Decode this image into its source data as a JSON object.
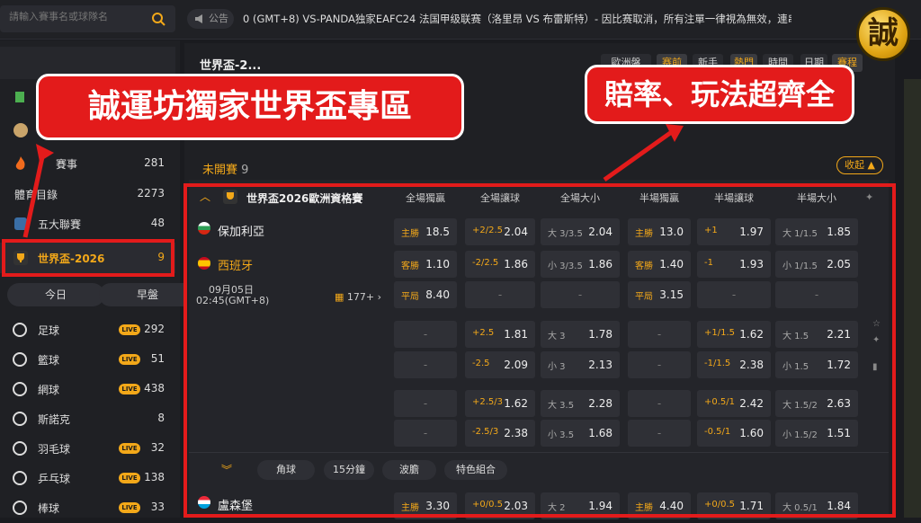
{
  "search": {
    "placeholder": "請輸入賽事名或球隊名"
  },
  "announcement": {
    "label": "公告",
    "text": "0 (GMT+8) VS-PANDA独家EAFC24 法国甲级联赛（洛里昂 VS 布雷斯特）- 因比赛取消，所有注單一律視為無效，連串注"
  },
  "logo_char": "誠",
  "sidebar": {
    "items_top": [
      {
        "label": "賽事",
        "count": "281"
      },
      {
        "label": "體育目錄",
        "count": "2273"
      },
      {
        "label": "五大聯賽",
        "count": "48"
      }
    ],
    "worldcup": {
      "label": "世界盃-2026",
      "count": "9"
    },
    "today_label": "今日",
    "early_label": "早盤",
    "sports": [
      {
        "label": "足球",
        "live": "LIVE",
        "count": "292",
        "icon": "soccer-icon"
      },
      {
        "label": "籃球",
        "live": "LIVE",
        "count": "51",
        "icon": "basketball-icon"
      },
      {
        "label": "網球",
        "live": "LIVE",
        "count": "438",
        "icon": "tennis-icon"
      },
      {
        "label": "斯諾克",
        "live": "",
        "count": "8",
        "icon": "snooker-icon"
      },
      {
        "label": "羽毛球",
        "live": "LIVE",
        "count": "32",
        "icon": "badminton-icon"
      },
      {
        "label": "乒乓球",
        "live": "LIVE",
        "count": "138",
        "icon": "pingpong-icon"
      },
      {
        "label": "棒球",
        "live": "LIVE",
        "count": "33",
        "icon": "baseball-icon"
      }
    ]
  },
  "main": {
    "breadcrumb": "世界盃-2...",
    "filters": [
      "歐洲盤",
      "赛前",
      "新手",
      "熱門",
      "時間",
      "日期",
      "賽程"
    ],
    "section_label": "未開賽",
    "section_count": "9",
    "collapse_label": "收起",
    "league": "世界盃2026歐洲資格賽",
    "headers": [
      "全場獨贏",
      "全場讓球",
      "全場大小",
      "半場獨贏",
      "半場讓球",
      "半場大小"
    ],
    "match": {
      "home": "保加利亞",
      "away": "西班牙",
      "date": "09月05日",
      "time": "02:45(GMT+8)",
      "more": "177+"
    },
    "rows": [
      [
        "主勝|18.5",
        "+2/2.5|2.04",
        "大 3/3.5|2.04",
        "主勝|13.0",
        "+1|1.97",
        "大 1/1.5|1.85"
      ],
      [
        "客勝|1.10",
        "-2/2.5|1.86",
        "小 3/3.5|1.86",
        "客勝|1.40",
        "-1|1.93",
        "小 1/1.5|2.05"
      ],
      [
        "平局|8.40",
        "-",
        "-",
        "平局|3.15",
        "-",
        "-"
      ],
      [
        "-",
        "+2.5|1.81",
        "大 3|1.78",
        "-",
        "+1/1.5|1.62",
        "大 1.5|2.21"
      ],
      [
        "-",
        "-2.5|2.09",
        "小 3|2.13",
        "-",
        "-1/1.5|2.38",
        "小 1.5|1.72"
      ],
      [
        "-",
        "+2.5/3|1.62",
        "大 3.5|2.28",
        "-",
        "+0.5/1|2.42",
        "大 1.5/2|2.63"
      ],
      [
        "-",
        "-2.5/3|2.38",
        "小 3.5|1.68",
        "-",
        "-0.5/1|1.60",
        "小 1.5/2|1.51"
      ]
    ],
    "tabs": [
      "角球",
      "15分鐘",
      "波膽",
      "特色組合"
    ],
    "next_team": "盧森堡",
    "next_row": [
      "主勝|3.30",
      "+0/0.5|2.03",
      "大 2|1.94",
      "主勝|4.40",
      "+0/0.5|1.71",
      "大 0.5/1|1.84"
    ]
  },
  "overlay": {
    "callout_left": "誠運坊獨家世界盃專區",
    "callout_right": "賠率、玩法超齊全"
  }
}
